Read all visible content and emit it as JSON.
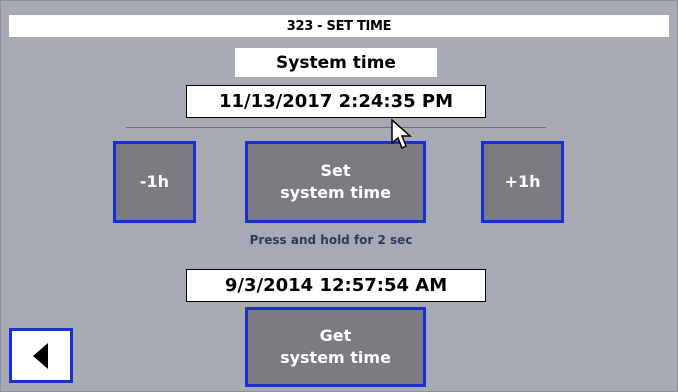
{
  "window": {
    "title": "323 - SET TIME"
  },
  "system_time": {
    "label": "System time",
    "value": "11/13/2017 2:24:35 PM"
  },
  "buttons": {
    "minus_hour": "-1h",
    "set_time_line1": "Set",
    "set_time_line2": "system time",
    "plus_hour": "+1h",
    "get_time_line1": "Get",
    "get_time_line2": "system time"
  },
  "hint": "Press and hold for 2 sec",
  "retrieved_time": {
    "value": "9/3/2014 12:57:54 AM"
  },
  "icons": {
    "back": "back-arrow-icon",
    "cursor": "mouse-pointer-icon"
  },
  "colors": {
    "background": "#a7aab4",
    "button_fill": "#7b7c82",
    "button_border": "#1a2fd0"
  }
}
